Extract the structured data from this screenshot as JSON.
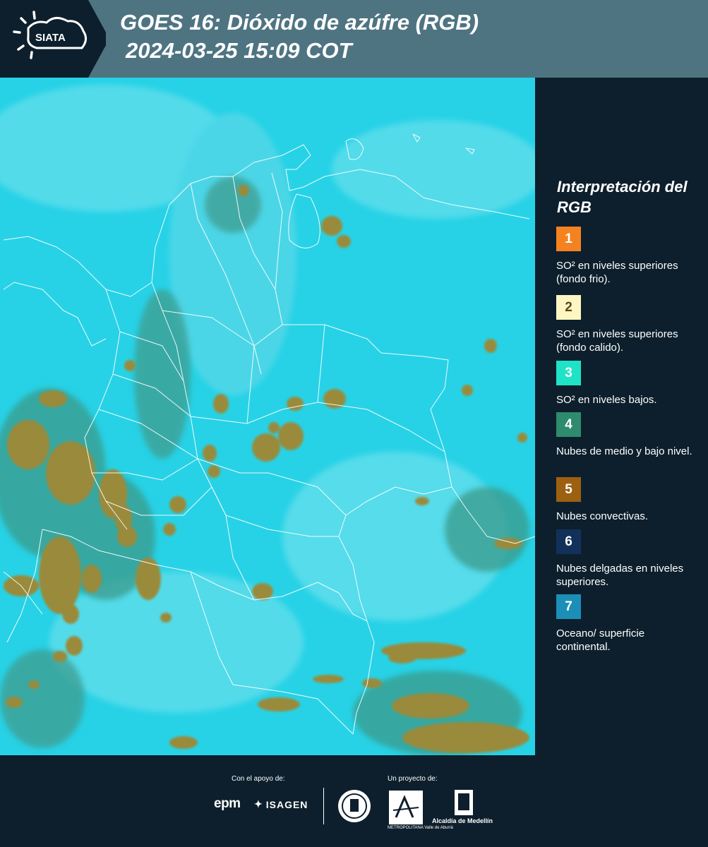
{
  "header": {
    "logo_text": "SIATA",
    "title": "GOES 16: Dióxido de azúfre (RGB)",
    "timestamp": "2024-03-25 15:09 COT",
    "background": "#4e7482"
  },
  "map": {
    "description_icon": "satellite-rgb-map",
    "base_color": "#27d2e6",
    "cloud_color": "#9a8a3a",
    "border_color": "#ffffff"
  },
  "legend": {
    "title": "Interpretación del RGB",
    "items": [
      {
        "number": "1",
        "color": "#f58220",
        "text": "SO² en niveles superiores (fondo frio)."
      },
      {
        "number": "2",
        "color": "#fdf6c3",
        "text": "SO² en niveles superiores (fondo calido)."
      },
      {
        "number": "3",
        "color": "#1fe3c6",
        "text": "SO² en niveles bajos."
      },
      {
        "number": "4",
        "color": "#2e8b6e",
        "text": "Nubes de medio y bajo nivel."
      },
      {
        "number": "5",
        "color": "#9c6010",
        "text": "Nubes convectivas."
      },
      {
        "number": "6",
        "color": "#12315a",
        "text": "Nubes delgadas en niveles superiores."
      },
      {
        "number": "7",
        "color": "#1b8fb8",
        "text": "Oceano/ superficie continental."
      }
    ]
  },
  "footer": {
    "support_label": "Con el apoyo de:",
    "project_label": "Un proyecto de:",
    "epm": "epm",
    "isagen": "ISAGEN",
    "amva": "METROPOLITANA Valle de Aburrá",
    "alcaldia": "Alcaldía de Medellín"
  }
}
